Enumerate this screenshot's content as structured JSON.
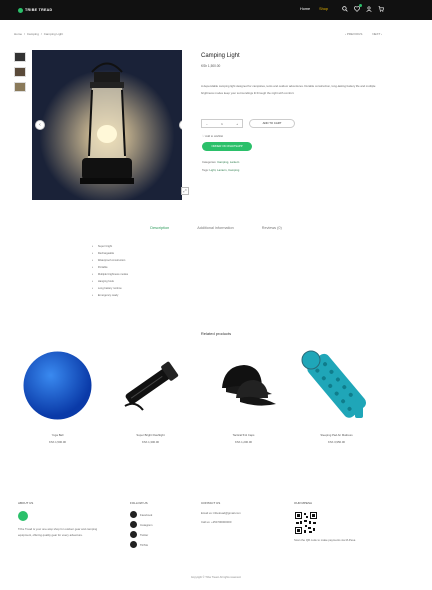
{
  "header": {
    "logo_text": "TRIBE TREAD",
    "nav": [
      {
        "label": "Home"
      },
      {
        "label": "Shop"
      }
    ],
    "wishlist_count": ""
  },
  "breadcrumb": {
    "items": [
      "Home",
      "/",
      "Camping",
      "/",
      "Camping Light"
    ]
  },
  "pagination": {
    "previous": "PREVIOUS",
    "next": "NEXT"
  },
  "product": {
    "title": "Camping Light",
    "price": "KSh 1,500.00",
    "description": "A dependable camping light designed for campsites, tents and outdoor adventures. Durable construction, long-lasting battery life and multiple brightness modes keep your surroundings lit through the night with comfort.",
    "qty": "1",
    "add_to_cart": "ADD TO CART",
    "wishlist": "Add to wishlist",
    "buy_now": "ORDER ON WHATSAPP",
    "category_label": "Categories:",
    "category": "Camping, Lantern",
    "tags_label": "Tags:",
    "tags": "Light, Lantern, Camping"
  },
  "tabs": [
    {
      "label": "Description"
    },
    {
      "label": "Additional information"
    },
    {
      "label": "Reviews (0)"
    }
  ],
  "features": [
    "Super bright",
    "Rechargeable",
    "Waterproof construction",
    "Portable",
    "Multiple brightness modes",
    "Hanging hook",
    "Long battery runtime",
    "Emergency ready"
  ],
  "related": {
    "title": "Related products",
    "items": [
      {
        "name": "Yoga Ball",
        "price": "KSh 1,500.00"
      },
      {
        "name": "Super Bright Flashlight",
        "price": "KSh 1,300.00"
      },
      {
        "name": "Tactical 511 Caps",
        "price": "KSh 1,200.00"
      },
      {
        "name": "Sleeping Pad Air Mattress",
        "price": "KSh 3,950.00"
      }
    ]
  },
  "footer": {
    "about": {
      "heading": "ABOUT US",
      "text": "Tribe Tread is your one-stop shop for outdoor gear and camping equipment, offering quality gear for every adventure."
    },
    "follow": {
      "heading": "FOLLOW US",
      "items": [
        "Facebook",
        "Instagram",
        "Twitter",
        "TikTok"
      ]
    },
    "contact": {
      "heading": "CONTACT US",
      "email": "Email us: tribetread@gmail.com",
      "phone": "Call us: +254700000000"
    },
    "payment": {
      "heading": "OUR MPESA",
      "text": "Scan the QR code to make payments via M-Pesa"
    },
    "copyright": "Copyright © Tribe Tread. All rights reserved."
  },
  "colors": {
    "accent": "#2bc06a",
    "topbar": "#111111"
  }
}
